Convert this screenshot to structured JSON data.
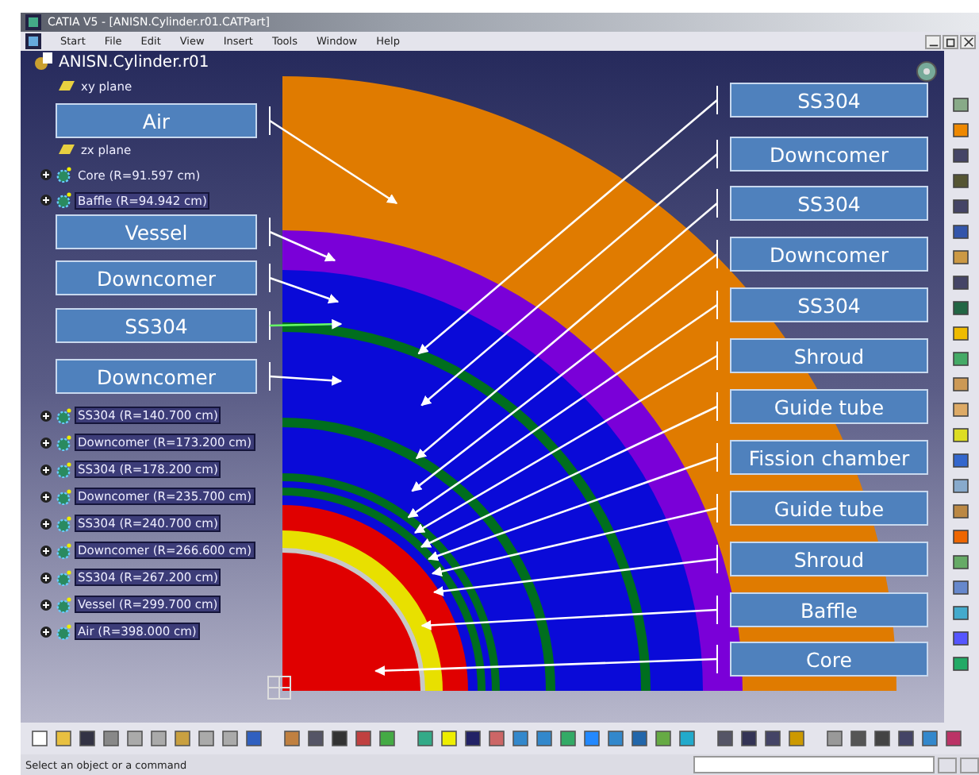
{
  "window": {
    "title": "CATIA V5 - [ANISN.Cylinder.r01.CATPart]"
  },
  "menu": [
    "Start",
    "File",
    "Edit",
    "View",
    "Insert",
    "Tools",
    "Window",
    "Help"
  ],
  "tree": {
    "root": "ANISN.Cylinder.r01",
    "upper_items": [
      {
        "label": "xy plane",
        "kind": "plane"
      },
      {
        "label": "zx plane",
        "kind": "plane"
      },
      {
        "label": "Core (R=91.597 cm)",
        "kind": "body",
        "selected": false
      },
      {
        "label": "Baffle (R=94.942 cm)",
        "kind": "body",
        "selected": true
      }
    ],
    "lower_items": [
      {
        "label": "SS304 (R=140.700 cm)",
        "kind": "body",
        "selected": true
      },
      {
        "label": "Downcomer (R=173.200 cm)",
        "kind": "body",
        "selected": true
      },
      {
        "label": "SS304 (R=178.200 cm)",
        "kind": "body",
        "selected": true
      },
      {
        "label": "Downcomer (R=235.700 cm)",
        "kind": "body",
        "selected": true
      },
      {
        "label": "SS304 (R=240.700 cm)",
        "kind": "body",
        "selected": true
      },
      {
        "label": "Downcomer (R=266.600 cm)",
        "kind": "body",
        "selected": true
      },
      {
        "label": "SS304 (R=267.200 cm)",
        "kind": "body",
        "selected": true
      },
      {
        "label": "Vessel (R=299.700 cm)",
        "kind": "body",
        "selected": true
      },
      {
        "label": "Air (R=398.000 cm)",
        "kind": "body",
        "selected": true
      }
    ]
  },
  "left_labels": [
    "Air",
    "Vessel",
    "Downcomer",
    "SS304",
    "Downcomer"
  ],
  "right_labels": [
    "SS304",
    "Downcomer",
    "SS304",
    "Downcomer",
    "SS304",
    "Shroud",
    "Guide tube",
    "Fission chamber",
    "Guide tube",
    "Shroud",
    "Baffle",
    "Core"
  ],
  "status_bar": {
    "message": "Select an object or a command"
  }
}
